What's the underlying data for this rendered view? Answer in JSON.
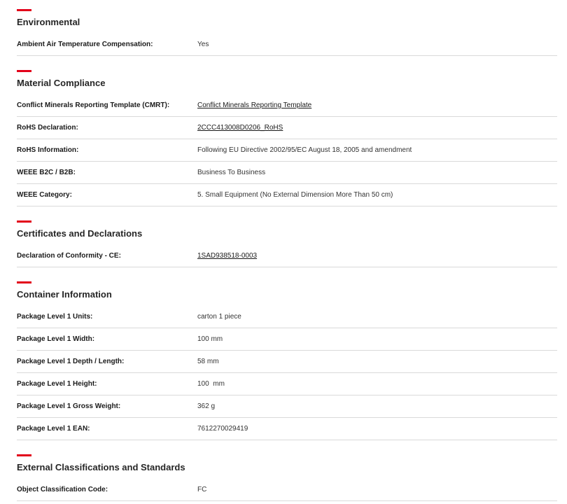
{
  "sections": [
    {
      "title": "Environmental",
      "rows": [
        {
          "label": "Ambient Air Temperature Compensation:",
          "value": "Yes",
          "link": false
        }
      ]
    },
    {
      "title": "Material Compliance",
      "rows": [
        {
          "label": "Conflict Minerals Reporting Template (CMRT):",
          "value": "Conflict Minerals Reporting Template",
          "link": true
        },
        {
          "label": "RoHS Declaration:",
          "value": "2CCC413008D0206_RoHS",
          "link": true
        },
        {
          "label": "RoHS Information:",
          "value": "Following EU Directive 2002/95/EC August 18, 2005 and amendment",
          "link": false
        },
        {
          "label": "WEEE B2C / B2B:",
          "value": "Business To Business",
          "link": false
        },
        {
          "label": "WEEE Category:",
          "value": "5. Small Equipment (No External Dimension More Than 50 cm)",
          "link": false
        }
      ]
    },
    {
      "title": "Certificates and Declarations",
      "rows": [
        {
          "label": "Declaration of Conformity - CE:",
          "value": "1SAD938518-0003",
          "link": true
        }
      ]
    },
    {
      "title": "Container Information",
      "rows": [
        {
          "label": "Package Level 1 Units:",
          "value": "carton 1 piece",
          "link": false
        },
        {
          "label": "Package Level 1 Width:",
          "value": "100 mm",
          "link": false
        },
        {
          "label": "Package Level 1 Depth / Length:",
          "value": "58 mm",
          "link": false
        },
        {
          "label": "Package Level 1 Height:",
          "value": "100  mm",
          "link": false
        },
        {
          "label": "Package Level 1 Gross Weight:",
          "value": "362 g",
          "link": false
        },
        {
          "label": "Package Level 1 EAN:",
          "value": "7612270029419",
          "link": false
        }
      ]
    },
    {
      "title": "External Classifications and Standards",
      "rows": [
        {
          "label": "Object Classification Code:",
          "value": "FC",
          "link": false
        }
      ]
    }
  ],
  "colors": {
    "accent": "#e2001a",
    "divider": "#d9d9d9"
  }
}
